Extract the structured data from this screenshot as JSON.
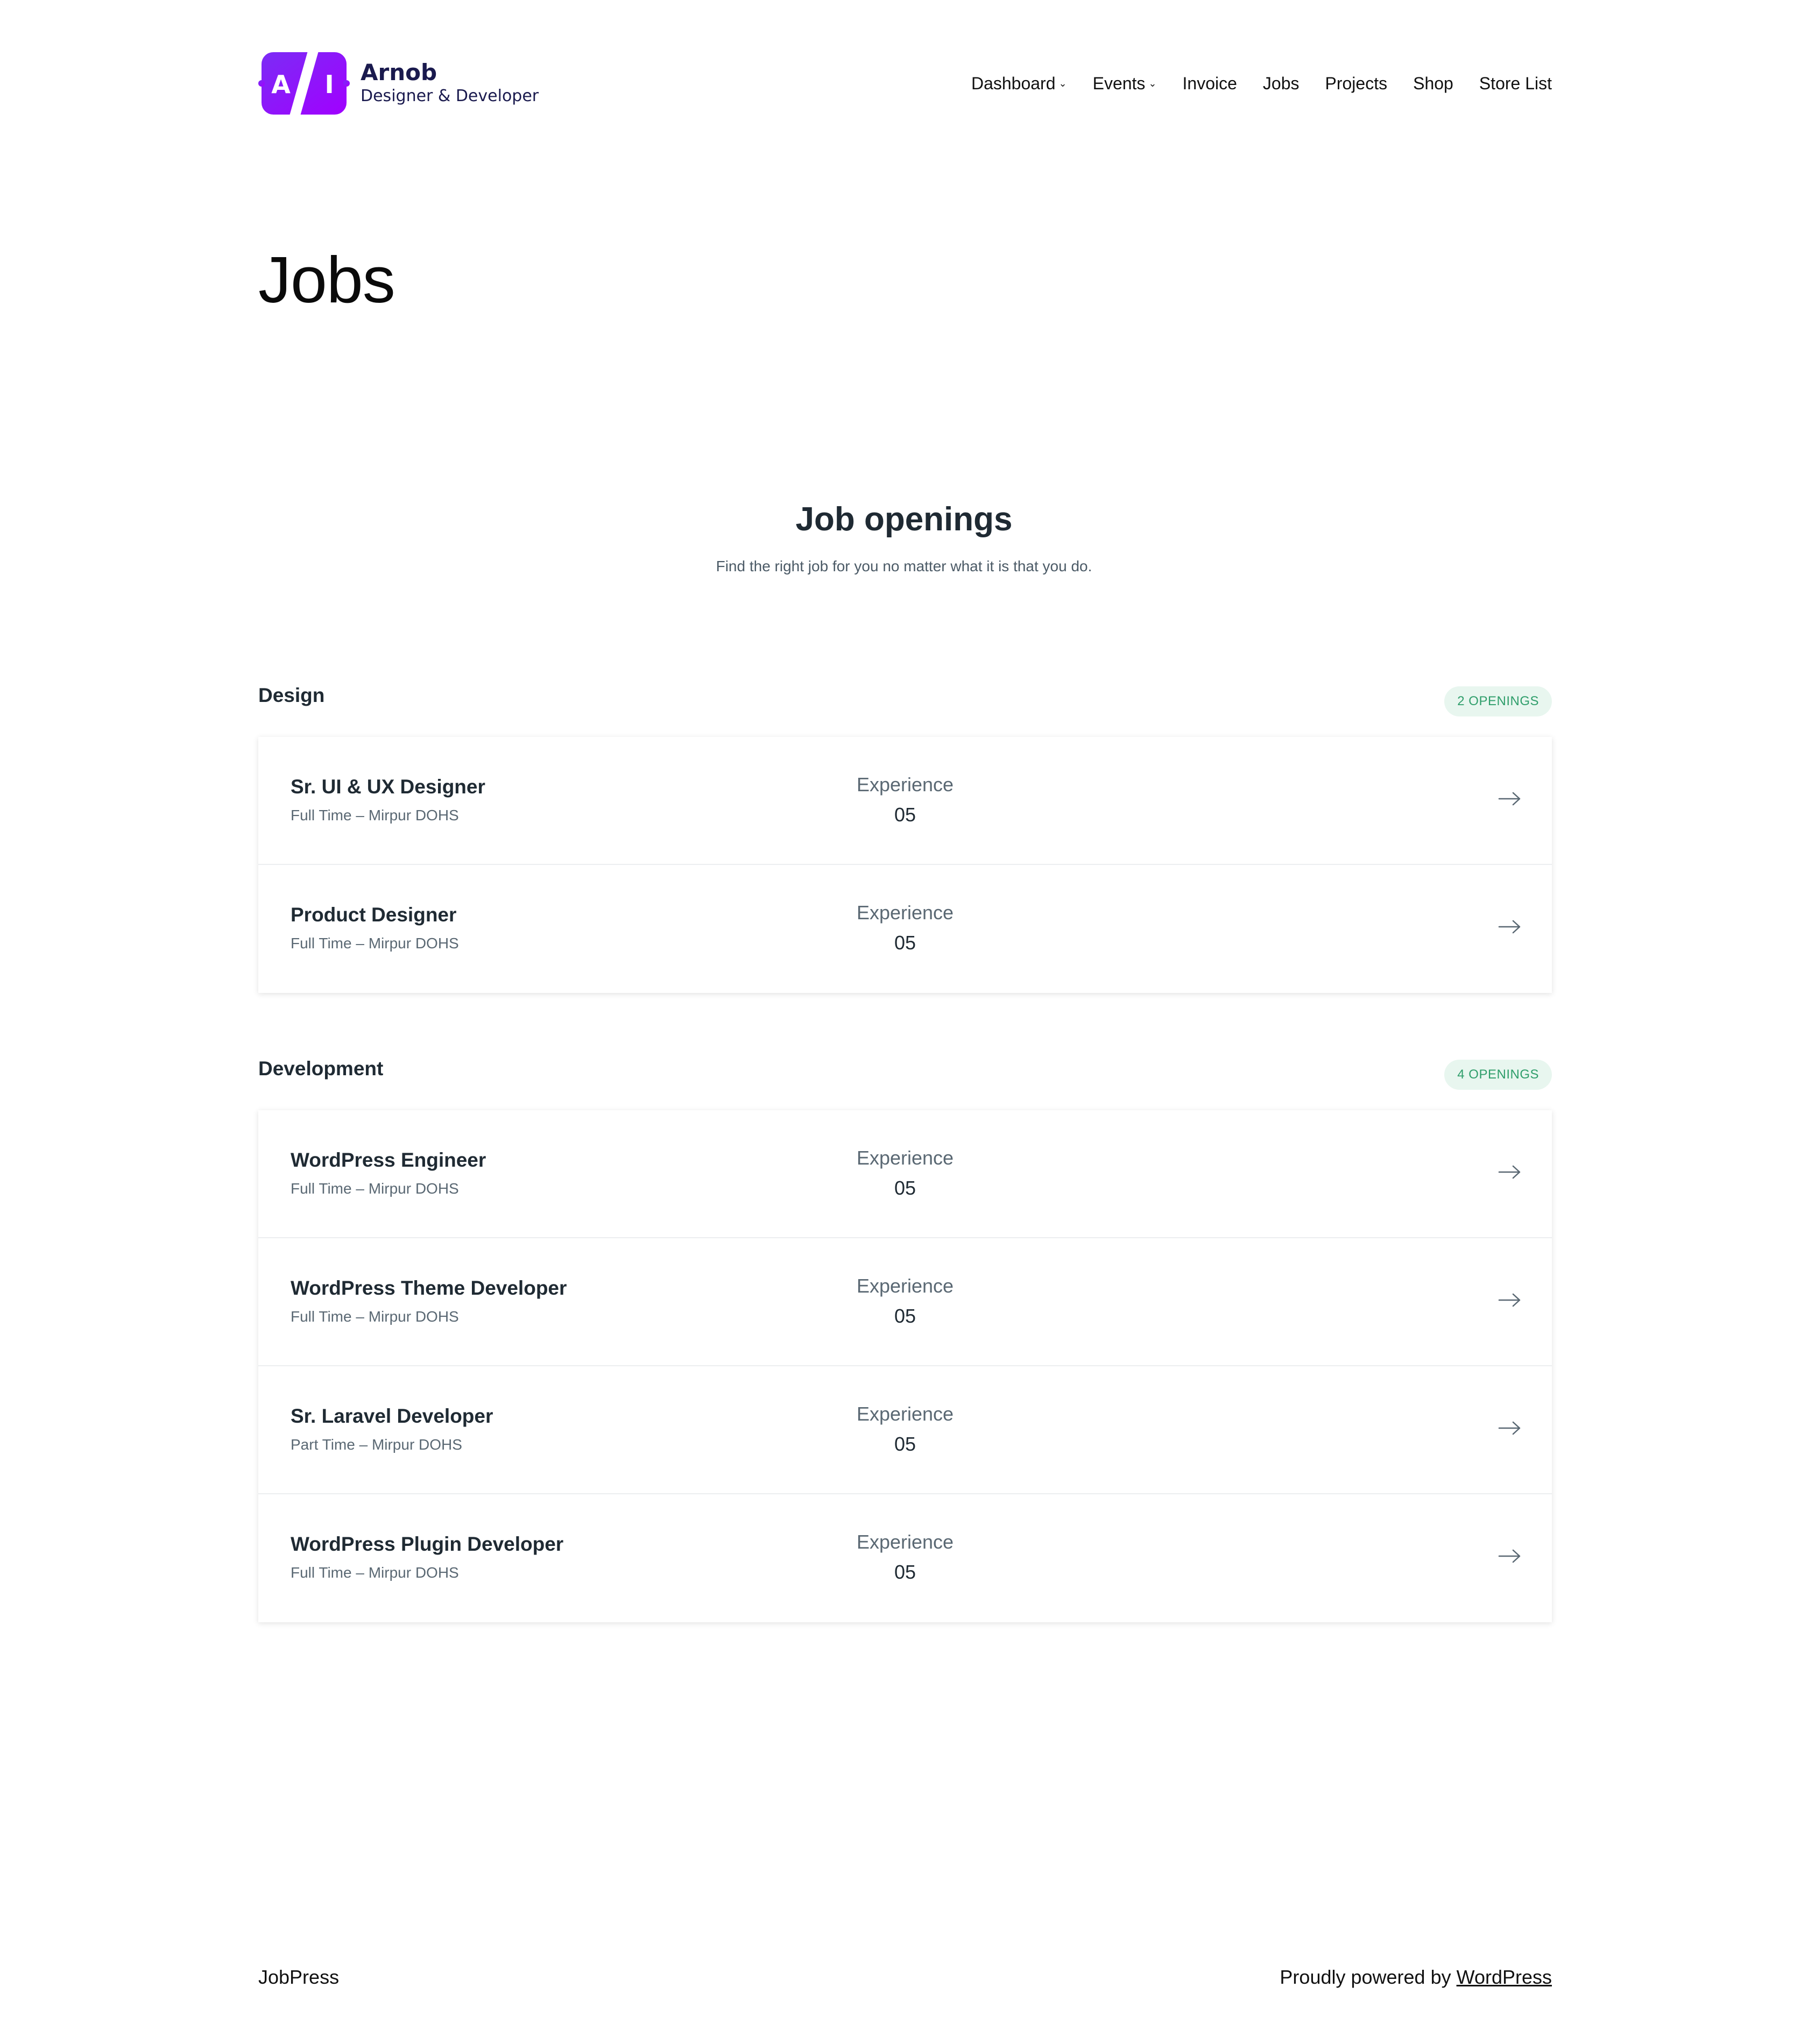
{
  "header": {
    "logo_letters": [
      "A",
      "I"
    ],
    "logo_name": "Arnob",
    "logo_tagline": "Designer & Developer",
    "nav": [
      {
        "label": "Dashboard",
        "has_dropdown": true
      },
      {
        "label": "Events",
        "has_dropdown": true
      },
      {
        "label": "Invoice",
        "has_dropdown": false
      },
      {
        "label": "Jobs",
        "has_dropdown": false
      },
      {
        "label": "Projects",
        "has_dropdown": false
      },
      {
        "label": "Shop",
        "has_dropdown": false
      },
      {
        "label": "Store List",
        "has_dropdown": false
      }
    ],
    "chevron_glyph": "⌄"
  },
  "page": {
    "title": "Jobs"
  },
  "openings": {
    "title": "Job openings",
    "subtitle": "Find the right job for you no matter what it is that you do."
  },
  "categories": [
    {
      "name": "Design",
      "badge": "2 OPENINGS",
      "jobs": [
        {
          "title": "Sr. UI & UX Designer",
          "meta": "Full Time – Mirpur DOHS",
          "exp_label": "Experience",
          "exp_value": "05"
        },
        {
          "title": "Product Designer",
          "meta": "Full Time – Mirpur DOHS",
          "exp_label": "Experience",
          "exp_value": "05"
        }
      ]
    },
    {
      "name": "Development",
      "badge": "4 OPENINGS",
      "jobs": [
        {
          "title": "WordPress Engineer",
          "meta": "Full Time – Mirpur DOHS",
          "exp_label": "Experience",
          "exp_value": "05"
        },
        {
          "title": "WordPress Theme Developer",
          "meta": "Full Time – Mirpur DOHS",
          "exp_label": "Experience",
          "exp_value": "05"
        },
        {
          "title": "Sr. Laravel Developer",
          "meta": "Part Time – Mirpur DOHS",
          "exp_label": "Experience",
          "exp_value": "05"
        },
        {
          "title": "WordPress Plugin Developer",
          "meta": "Full Time – Mirpur DOHS",
          "exp_label": "Experience",
          "exp_value": "05"
        }
      ]
    }
  ],
  "footer": {
    "site_name": "JobPress",
    "powered_prefix": "Proudly powered by ",
    "powered_link": "WordPress"
  },
  "colors": {
    "brand_gradient_start": "#7b2cf5",
    "brand_gradient_end": "#a100ff",
    "badge_bg": "#e8f6ef",
    "badge_text": "#2f9e6b",
    "heading": "#1f2a33",
    "muted": "#5a6873"
  }
}
